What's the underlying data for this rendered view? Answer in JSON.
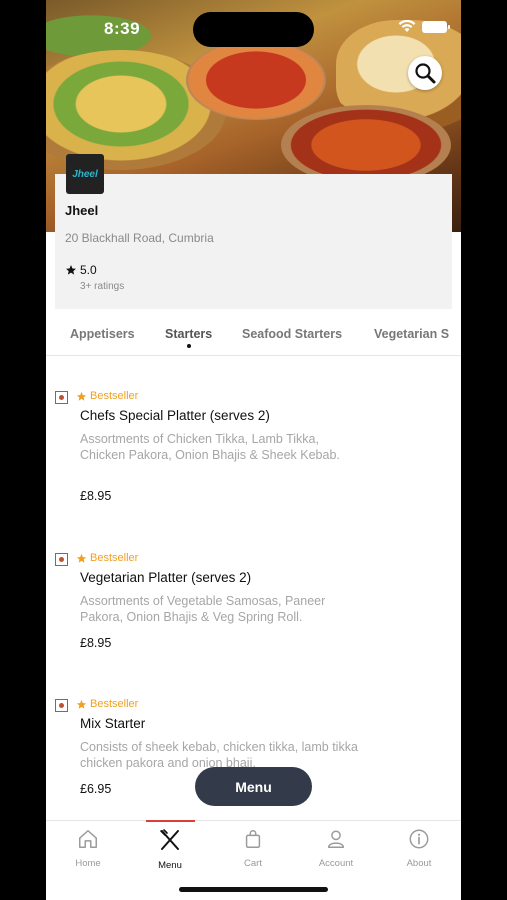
{
  "status": {
    "time": "8:39"
  },
  "restaurant": {
    "logo_text": "Jheel",
    "name": "Jheel",
    "address": "20 Blackhall Road, Cumbria",
    "rating": "5.0",
    "ratings_count": "3+ ratings"
  },
  "categories": [
    "Appetisers",
    "Starters",
    "Seafood Starters",
    "Vegetarian S"
  ],
  "active_category": "Starters",
  "items": [
    {
      "badge": "Bestseller",
      "title": "Chefs Special Platter (serves 2)",
      "desc": "Assortments of Chicken Tikka, Lamb Tikka, Chicken Pakora, Onion Bhajis & Sheek Kebab.",
      "price": "£8.95"
    },
    {
      "badge": "Bestseller",
      "title": "Vegetarian Platter  (serves 2)",
      "desc": "Assortments of Vegetable Samosas, Paneer Pakora, Onion Bhajis & Veg Spring Roll.",
      "price": "£8.95"
    },
    {
      "badge": "Bestseller",
      "title": "Mix Starter",
      "desc": "Consists of sheek kebab, chicken tikka, lamb tikka chicken pakora and onion bhaji.",
      "price": "£6.95"
    }
  ],
  "menu_button": "Menu",
  "tabbar": [
    {
      "label": "Home",
      "icon": "home-icon"
    },
    {
      "label": "Menu",
      "icon": "fork-knife-icon"
    },
    {
      "label": "Cart",
      "icon": "bag-icon"
    },
    {
      "label": "Account",
      "icon": "person-icon"
    },
    {
      "label": "About",
      "icon": "info-icon"
    }
  ],
  "colors": {
    "accent": "#d9403a",
    "bestseller": "#f0a020",
    "fab": "#333a4a",
    "veg_mark": "#c0522e"
  }
}
